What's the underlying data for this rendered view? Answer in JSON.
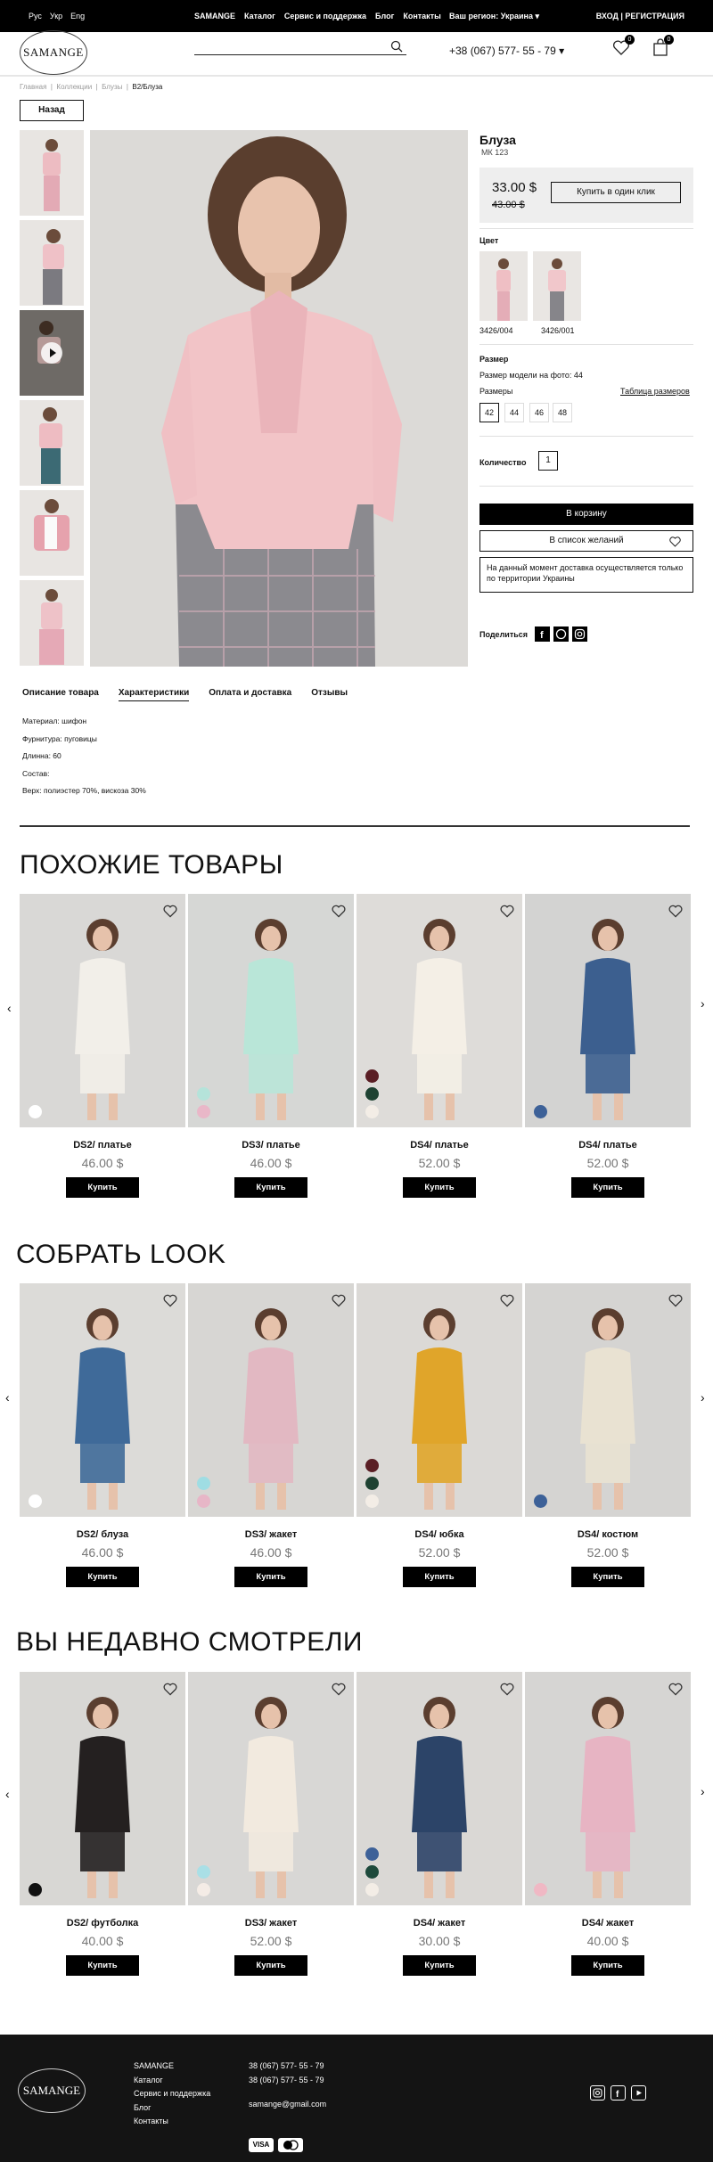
{
  "topbar": {
    "langs": [
      "Рус",
      "Укр",
      "Eng"
    ],
    "nav": [
      "SAMANGE",
      "Каталог",
      "Сервис и поддержка",
      "Блог",
      "Контакты"
    ],
    "region": "Ваш регион: Украина ▾",
    "auth": "ВХОД  |  РЕГИСТРАЦИЯ"
  },
  "header": {
    "logo": "SAMANGE",
    "phone": "+38 (067) 577- 55 - 79 ▾",
    "wishlist_count": "0",
    "cart_count": "0"
  },
  "breadcrumbs": [
    "Главная",
    "Коллекции",
    "Блузы",
    "B2/Блуза"
  ],
  "back_label": "Назад",
  "product": {
    "name": "Блуза",
    "sku": "МК 123",
    "price": "33.00 $",
    "old_price": "43.00 $",
    "one_click": "Купить в один клик",
    "color_label": "Цвет",
    "colors": [
      "3426/004",
      "3426/001"
    ],
    "size_label": "Размер",
    "model_size": "Размер модели на фото: 44",
    "sizes_label": "Размеры",
    "size_table": "Таблица размеров",
    "sizes": [
      "42",
      "44",
      "46",
      "48"
    ],
    "qty_label": "Количество",
    "qty": "1",
    "to_cart": "В корзину",
    "to_wishlist": "В список желаний",
    "delivery": "На данный момент доставка осуществляется только по территории Украины",
    "share": "Поделиться"
  },
  "tabs": [
    "Описание товара",
    "Характеристики",
    "Оплата и доставка",
    "Отзывы"
  ],
  "specs": [
    "Материал: шифон",
    "Фурнитура: пуговицы",
    "Длинна: 60",
    "Состав:",
    "Верх: полиэстер 70%, вискоза 30%"
  ],
  "sections": [
    {
      "title": "ПОХОЖИЕ ТОВАРЫ",
      "items": [
        {
          "name": "DS2/ платье",
          "price": "46.00 $",
          "buy": "Купить",
          "bg": "#d9d8d6",
          "garment": "#f2efe9",
          "dots": [
            "#ffffff"
          ]
        },
        {
          "name": "DS3/ платье",
          "price": "46.00 $",
          "buy": "Купить",
          "bg": "#d6d7d5",
          "garment": "#b9e6d8",
          "dots": [
            "#b5e3da",
            "#e9b7c8"
          ]
        },
        {
          "name": "DS4/ платье",
          "price": "52.00 $",
          "buy": "Купить",
          "bg": "#dedcd9",
          "garment": "#f4efe6",
          "dots": [
            "#5a1e24",
            "#1e4232",
            "#f3ede6"
          ]
        },
        {
          "name": "DS4/ платье",
          "price": "52.00 $",
          "buy": "Купить",
          "bg": "#d3d3d2",
          "garment": "#3c5f8f",
          "dots": [
            "#3d6198"
          ]
        }
      ]
    },
    {
      "title": "СОБРАТЬ LOOK",
      "items": [
        {
          "name": "DS2/ блуза",
          "price": "46.00 $",
          "buy": "Купить",
          "bg": "#dcdbd8",
          "garment": "#3f6a99",
          "dots": [
            "#ffffff"
          ]
        },
        {
          "name": "DS3/ жакет",
          "price": "46.00 $",
          "buy": "Купить",
          "bg": "#d7d6d3",
          "garment": "#e2b8c2",
          "dots": [
            "#9fdde3",
            "#e7b6c7"
          ]
        },
        {
          "name": "DS4/ юбка",
          "price": "52.00 $",
          "buy": "Купить",
          "bg": "#dbd9d6",
          "garment": "#e0a52a",
          "dots": [
            "#5a1e24",
            "#1e4232",
            "#f3ede6"
          ]
        },
        {
          "name": "DS4/ костюм",
          "price": "52.00 $",
          "buy": "Купить",
          "bg": "#d5d4d2",
          "garment": "#e9e2d2",
          "dots": [
            "#3d6198"
          ]
        }
      ]
    },
    {
      "title": "ВЫ НЕДАВНО СМОТРЕЛИ",
      "items": [
        {
          "name": "DS2/ футболка",
          "price": "40.00 $",
          "buy": "Купить",
          "bg": "#d8d7d4",
          "garment": "#242020",
          "dots": [
            "#111111"
          ]
        },
        {
          "name": "DS3/ жакет",
          "price": "52.00 $",
          "buy": "Купить",
          "bg": "#d8d7d5",
          "garment": "#f2eadf",
          "dots": [
            "#a9dfe6",
            "#f4ece6"
          ]
        },
        {
          "name": "DS4/ жакет",
          "price": "30.00 $",
          "buy": "Купить",
          "bg": "#dad8d5",
          "garment": "#2c4468",
          "dots": [
            "#3d6198",
            "#1e4a3c",
            "#f3ede6"
          ]
        },
        {
          "name": "DS4/ жакет",
          "price": "40.00 $",
          "buy": "Купить",
          "bg": "#d6d5d3",
          "garment": "#e7b4c3",
          "dots": [
            "#f0b8c4"
          ]
        }
      ]
    }
  ],
  "footer": {
    "logo": "SAMANGE",
    "links": [
      "SAMANGE",
      "Каталог",
      "Сервис и поддержка",
      "Блог",
      "Контакты"
    ],
    "phones": [
      "38 (067) 577- 55 - 79",
      "38 (067) 577- 55 - 79"
    ],
    "email": "samange@gmail.com",
    "pay": [
      "VISA",
      "MC"
    ]
  }
}
